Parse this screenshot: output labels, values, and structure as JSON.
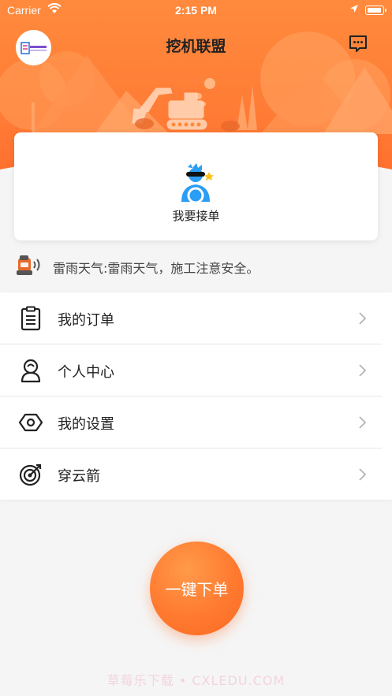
{
  "status_bar": {
    "carrier": "Carrier",
    "time": "2:15 PM"
  },
  "nav": {
    "title": "挖机联盟",
    "logo_icon": "alliance-logo-icon",
    "message_icon": "message-icon"
  },
  "accept_card": {
    "label": "我要接单",
    "icon": "driver-icon"
  },
  "notice": {
    "icon": "speaker-icon",
    "text": "雷雨天气:雷雨天气，施工注意安全。"
  },
  "menu": {
    "items": [
      {
        "label": "我的订单",
        "icon": "clipboard-icon"
      },
      {
        "label": "个人中心",
        "icon": "person-icon"
      },
      {
        "label": "我的设置",
        "icon": "settings-hex-icon"
      },
      {
        "label": "穿云箭",
        "icon": "target-icon"
      }
    ]
  },
  "order_button": {
    "label": "一键下单"
  },
  "watermark": {
    "text": "草莓乐下载 • CXLEDU.COM"
  },
  "colors": {
    "accent": "#ff7a30",
    "header_top": "#ff8a3d",
    "header_bottom": "#ff6a2b",
    "background": "#f5f5f5"
  }
}
